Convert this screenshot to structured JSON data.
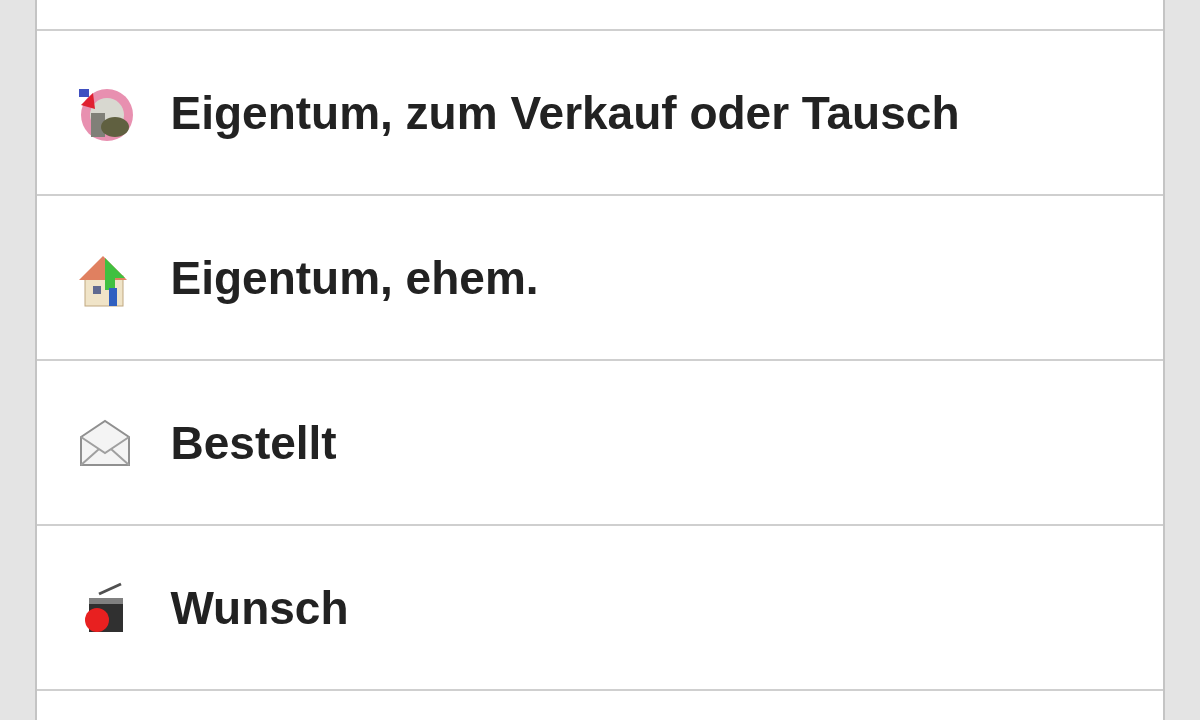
{
  "items": [
    {
      "kind": "disc",
      "label": "Eigentum, zum Verkauf oder Tausch"
    },
    {
      "kind": "house",
      "label": "Eigentum, ehem."
    },
    {
      "kind": "envelope",
      "label": "Bestellt"
    },
    {
      "kind": "clapper",
      "label": "Wunsch"
    }
  ]
}
